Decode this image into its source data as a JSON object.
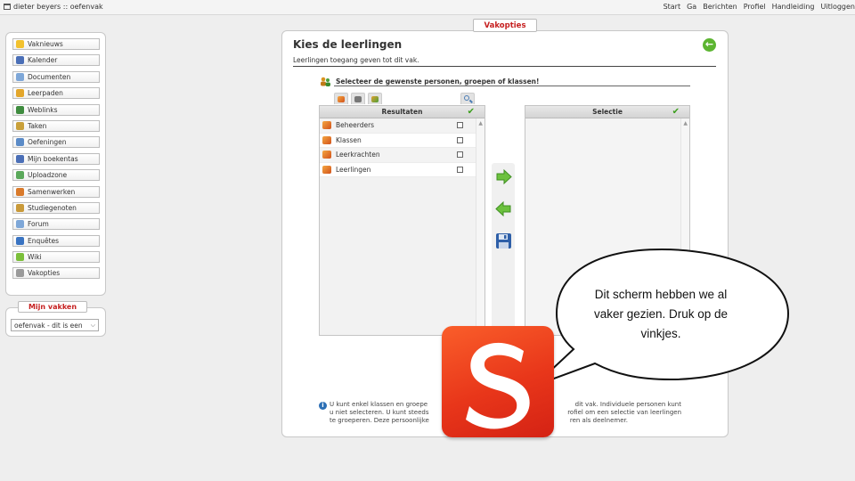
{
  "topbar": {
    "title": "dieter beyers :: oefenvak",
    "nav": [
      "Start",
      "Ga",
      "Berichten",
      "Profiel",
      "Handleiding",
      "Uitloggen"
    ]
  },
  "sidebar": {
    "items": [
      {
        "label": "Vaknieuws",
        "icon": "star-icon",
        "color": "#f2c12e"
      },
      {
        "label": "Kalender",
        "icon": "calendar-icon",
        "color": "#4b6fb7"
      },
      {
        "label": "Documenten",
        "icon": "documents-icon",
        "color": "#7ea7d8"
      },
      {
        "label": "Leerpaden",
        "icon": "learning-path-icon",
        "color": "#e3a62b"
      },
      {
        "label": "Weblinks",
        "icon": "globe-icon",
        "color": "#3f8c3f"
      },
      {
        "label": "Taken",
        "icon": "tasks-icon",
        "color": "#c9a03a"
      },
      {
        "label": "Oefeningen",
        "icon": "exercises-icon",
        "color": "#5b8bc7"
      },
      {
        "label": "Mijn boekentas",
        "icon": "bookbag-icon",
        "color": "#4b6fb7"
      },
      {
        "label": "Uploadzone",
        "icon": "upload-icon",
        "color": "#5aa85a"
      },
      {
        "label": "Samenwerken",
        "icon": "collaborate-icon",
        "color": "#d97a2b"
      },
      {
        "label": "Studiegenoten",
        "icon": "classmates-icon",
        "color": "#c99a3a"
      },
      {
        "label": "Forum",
        "icon": "forum-icon",
        "color": "#7ea7d8"
      },
      {
        "label": "Enquêtes",
        "icon": "survey-icon",
        "color": "#3a74c2"
      },
      {
        "label": "Wiki",
        "icon": "wiki-icon",
        "color": "#7bbf3a"
      },
      {
        "label": "Vakopties",
        "icon": "wrench-icon",
        "color": "#9a9a9a"
      }
    ]
  },
  "mijn_vakken": {
    "label": "Mijn vakken",
    "selected": "oefenvak - dit is een"
  },
  "main": {
    "tab_label": "Vakopties",
    "title": "Kies de leerlingen",
    "subtitle": "Leerlingen toegang geven tot dit vak.",
    "select_heading": "Selecteer de gewenste personen, groepen of klassen!",
    "results_header": "Resultaten",
    "selection_header": "Selectie",
    "results": [
      "Beheerders",
      "Klassen",
      "Leerkrachten",
      "Leerlingen"
    ],
    "info_line1": "U kunt enkel klassen en groepe",
    "info_line1b": "dit vak. Individuele personen kunt",
    "info_line2": "u niet selecteren. U kunt steeds",
    "info_line2b": "rofiel om een selectie van leerlingen",
    "info_line3": "te groeperen. Deze persoonlijke",
    "info_line3b": "ren als deelnemer."
  },
  "bubble": {
    "text": "Dit scherm hebben we al vaker gezien. Druk op de vinkjes."
  },
  "colors": {
    "accent_red": "#c62020",
    "check_green": "#3c9e1d",
    "logo_orange": "#e8361a"
  }
}
